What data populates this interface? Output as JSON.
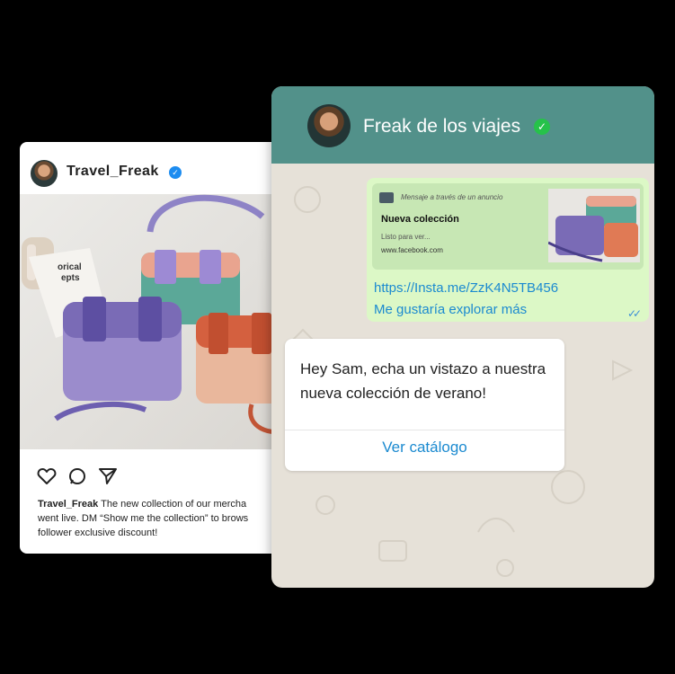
{
  "instagram": {
    "username": "Travel_Freak",
    "verified_icon": "verified-badge-icon",
    "photo_book_text": "orical\nepts",
    "actions": [
      "heart-icon",
      "comment-icon",
      "share-icon"
    ],
    "caption_user": "Travel_Freak",
    "caption_line1": " The new collection of our mercha",
    "caption_line2": "went live. DM “Show me the collection” to brows",
    "caption_line3": "follower exclusive discount!"
  },
  "whatsapp": {
    "contact_name": "Freak de los viajes",
    "verified_icon": "verified-badge-icon",
    "colors": {
      "header": "#52918a",
      "outgoing": "#dcf8c6",
      "link": "#1b8ad0",
      "verified": "#26c24a"
    },
    "outgoing": {
      "ad_note": "Mensaje a través de un anuncio",
      "ad_title": "Nueva colección",
      "ad_subtitle": "Listo para ver...",
      "ad_link": "www.facebook.com",
      "url": "https://Insta.me/ZzK4N5TB456",
      "text": "Me gustaría explorar más",
      "ticks": "✓✓"
    },
    "incoming": {
      "text": "Hey Sam, echa un vistazo a nuestra nueva colección de verano!",
      "button": "Ver catálogo"
    }
  }
}
